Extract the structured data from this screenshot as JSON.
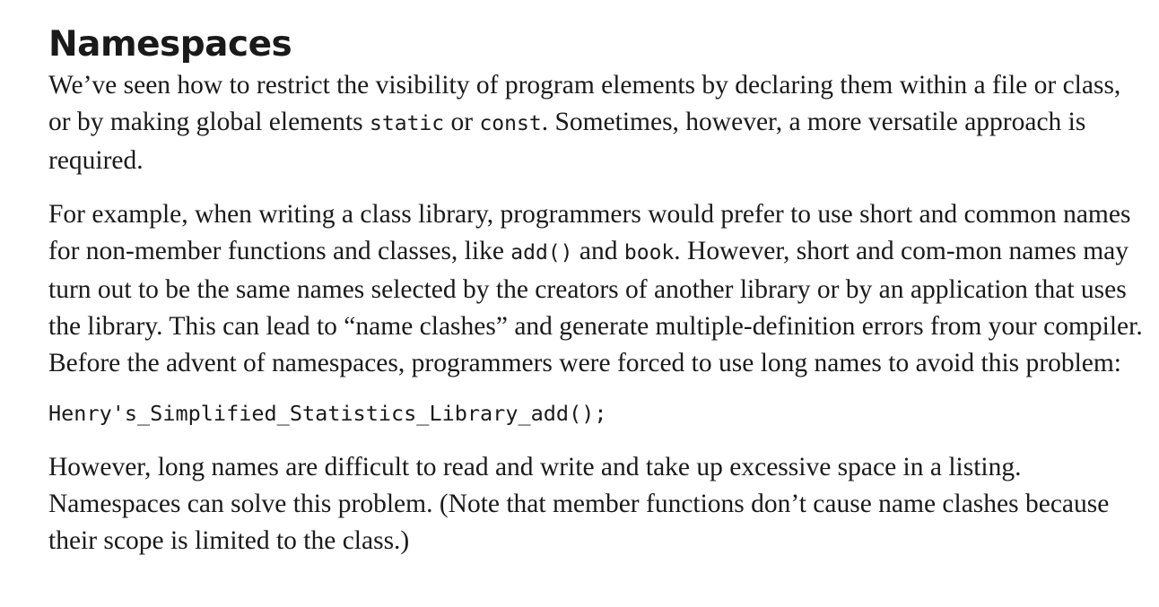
{
  "heading": "Namespaces",
  "para1": {
    "t1": "We’ve seen how to restrict the visibility of program elements by declaring them within a file or class, or by making global elements ",
    "c1": "static",
    "t2": " or ",
    "c2": "const",
    "t3": ". Sometimes, however, a more versatile approach is required."
  },
  "para2": {
    "t1": "For example, when writing a class library, programmers would prefer to use short and common names for non-member functions and classes, like ",
    "c1": "add()",
    "t2": " and ",
    "c2": "book",
    "t3": ". However, short and com-mon names may turn out to be the same names selected by the creators of another library or by an application that uses the library. This can lead to “name clashes” and generate multiple-definition errors from your compiler. Before the advent of namespaces, programmers were forced to use long names to avoid this problem:"
  },
  "code_example": "Henry's_Simplified_Statistics_Library_add();",
  "para3": "However, long names are difficult to read and write and take up excessive space in a listing. Namespaces can solve this problem. (Note that member functions don’t cause name clashes because their scope is limited to the class.)"
}
